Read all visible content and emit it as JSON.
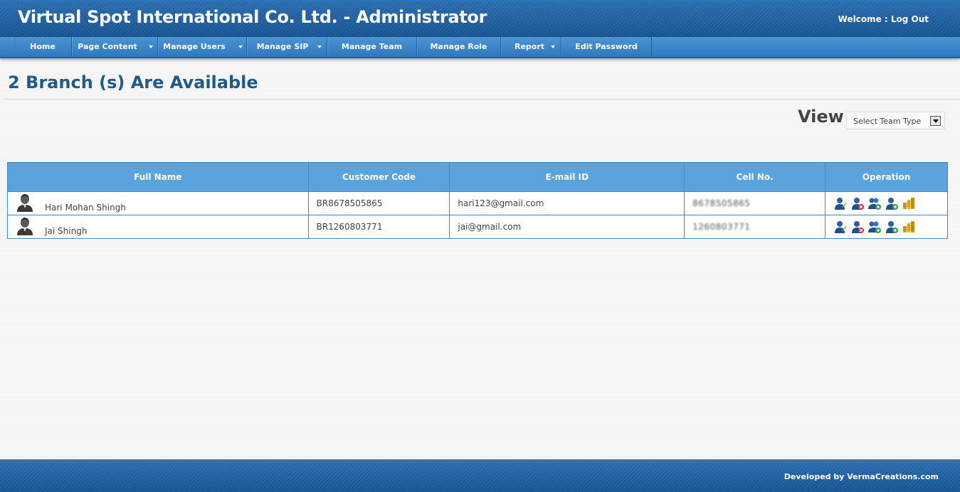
{
  "header": {
    "title": "Virtual Spot International Co. Ltd. - Administrator",
    "welcome_label": "Welcome",
    "separator": " : ",
    "logout_label": "Log Out"
  },
  "nav": {
    "items": [
      {
        "label": "Home",
        "has_dropdown": false
      },
      {
        "label": "Page Content",
        "has_dropdown": true
      },
      {
        "label": "Manage Users",
        "has_dropdown": true
      },
      {
        "label": "Manage SIP",
        "has_dropdown": true
      },
      {
        "label": "Manage Team",
        "has_dropdown": false
      },
      {
        "label": "Manage Role",
        "has_dropdown": false
      },
      {
        "label": "Report",
        "has_dropdown": true
      },
      {
        "label": "Edit Password",
        "has_dropdown": false
      }
    ]
  },
  "main": {
    "heading": "2 Branch (s) Are Available",
    "view_label": "View",
    "team_type_select": {
      "selected": "Select Team Type"
    }
  },
  "table": {
    "headers": [
      "Full Name",
      "Customer Code",
      "E-mail ID",
      "Cell No.",
      "Operation"
    ],
    "rows": [
      {
        "full_name": "Hari Mohan Shingh",
        "customer_code": "BR8678505865",
        "email": "hari123@gmail.com",
        "cell": "8678505865"
      },
      {
        "full_name": "Jai Shingh",
        "customer_code": "BR1260803771",
        "email": "jai@gmail.com",
        "cell": "1260803771"
      }
    ],
    "operation_icons": [
      "edit-user-icon",
      "delete-user-icon",
      "add-users-icon",
      "add-user-icon",
      "coins-icon"
    ]
  },
  "footer": {
    "credit": "Developed by VermaCreations.com"
  },
  "colors": {
    "header_bg": "#1b5c9e",
    "nav_bg": "#3a84c8",
    "table_header_bg": "#5aa3dc",
    "heading_text": "#1e5a8c"
  }
}
